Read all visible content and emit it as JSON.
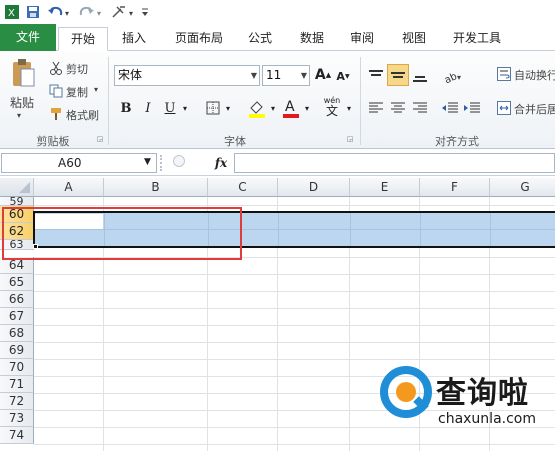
{
  "quick_access": {
    "save_icon": "save-icon",
    "undo_icon": "undo-icon",
    "redo_icon": "redo-icon",
    "customize_icon": "customize-icon"
  },
  "tabs": [
    {
      "label": "文件"
    },
    {
      "label": "开始"
    },
    {
      "label": "插入"
    },
    {
      "label": "页面布局"
    },
    {
      "label": "公式"
    },
    {
      "label": "数据"
    },
    {
      "label": "审阅"
    },
    {
      "label": "视图"
    },
    {
      "label": "开发工具"
    }
  ],
  "ribbon": {
    "clipboard": {
      "paste": "粘贴",
      "cut": "剪切",
      "copy": "复制",
      "format_painter": "格式刷",
      "group_label": "剪贴板"
    },
    "font": {
      "font_name": "宋体",
      "font_size": "11",
      "grow": "A",
      "shrink": "A",
      "bold": "B",
      "italic": "I",
      "underline": "U",
      "phonetic": "wén",
      "group_label": "字体"
    },
    "alignment": {
      "wrap_text": "自动换行",
      "merge_center": "合并后居",
      "group_label": "对齐方式"
    }
  },
  "formula_bar": {
    "name_box": "A60",
    "fx": "fx",
    "formula": ""
  },
  "grid": {
    "columns": [
      "A",
      "B",
      "C",
      "D",
      "E",
      "F",
      "G"
    ],
    "rows": [
      "59",
      "60",
      "62",
      "63",
      "64",
      "65",
      "66",
      "67",
      "68",
      "69",
      "70",
      "71",
      "72",
      "73",
      "74"
    ],
    "selected_rows": [
      "60",
      "62"
    ]
  },
  "watermark": {
    "brand": "查询啦",
    "url": "chaxunla.com"
  },
  "colors": {
    "file_tab": "#2a8d44",
    "selection": "#bcd6f0",
    "annotation": "#e03c3c"
  }
}
